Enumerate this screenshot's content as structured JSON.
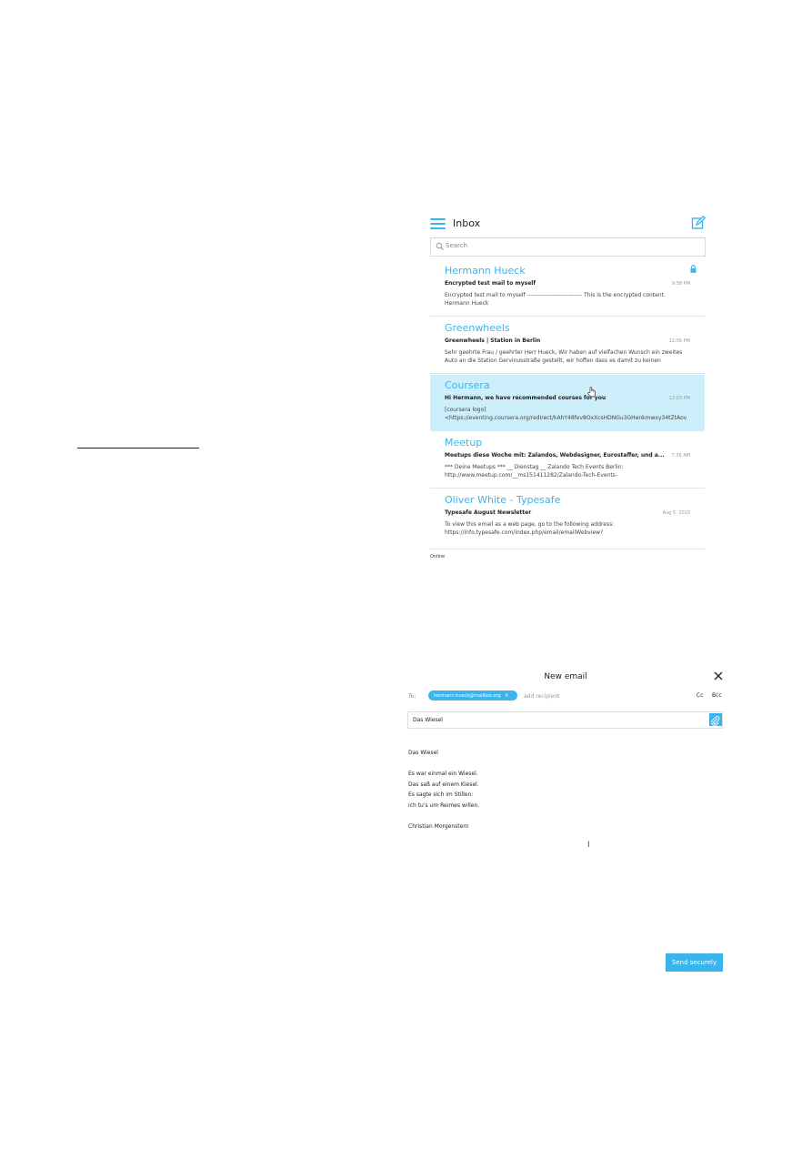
{
  "inbox": {
    "title": "Inbox",
    "search_placeholder": "Search",
    "messages": [
      {
        "sender": "Hermann Hueck",
        "subject": "Encrypted test mail to myself",
        "time": "9:58 PM",
        "preview_1": "Encrypted test mail to myself ---------------------------- This is the encrypted content.",
        "preview_2": "Hermann Hueck",
        "encrypted": true
      },
      {
        "sender": "Greenwheels",
        "subject": "Greenwheels | Station in Berlin",
        "time": "12:56 PM",
        "preview_1": "Sehr geehrte Frau / geehrter Herr Hueck, Wir haben auf vielfachen Wunsch ein zweites",
        "preview_2": "Auto an die Station Gervinusstraße gestellt, wir hoffen dass es damit zu keinen"
      },
      {
        "sender": "Coursera",
        "subject": "Hi Hermann, we have recommended courses for you",
        "time": "12:03 PM",
        "preview_1": "[coursera logo]",
        "preview_2": "<https://eventing.coursera.org/redirect/kAhY48fev8OxXcsHDNGu3GHenkmwxy34tZtAov",
        "selected": true
      },
      {
        "sender": "Meetup",
        "subject": "Meetups diese Woche mit: Zalandos, Webdesigner, Eurostaffer, und a...",
        "time": "7:36 AM",
        "preview_1": "*** Deine Meetups *** __ Dienstag __ Zalando Tech Events Berlin:",
        "preview_2": "http://www.meetup.com/__ms151411282/Zalando-Tech-Events-"
      },
      {
        "sender": "Oliver White - Typesafe",
        "subject": "Typesafe August Newsletter",
        "time": "Aug 5, 2015",
        "preview_1": "To view this email as a web page, go to the following address:",
        "preview_2": "https://info.typesafe.com/index.php/email/emailWebview?"
      }
    ],
    "status": "Online"
  },
  "compose": {
    "title": "New email",
    "to_label": "To:",
    "recipient": "hermann.hueck@mailbox.org",
    "chip_remove": "×",
    "add_recipient_placeholder": "add recipient",
    "cc_label": "Cc",
    "bcc_label": "Bcc",
    "subject": "Das Wiesel",
    "body": [
      "Das Wiesel",
      "",
      "Es war einmal ein Wiesel.",
      "Das saß auf einem Kiesel.",
      "Es sagte sich im Stillen:",
      "ich tu's um Reimes willen.",
      "",
      "Christian Morgenstern"
    ],
    "send_label": "Send securely"
  },
  "colors": {
    "accent": "#3ab4ec",
    "selected_row": "#cdeefb"
  }
}
